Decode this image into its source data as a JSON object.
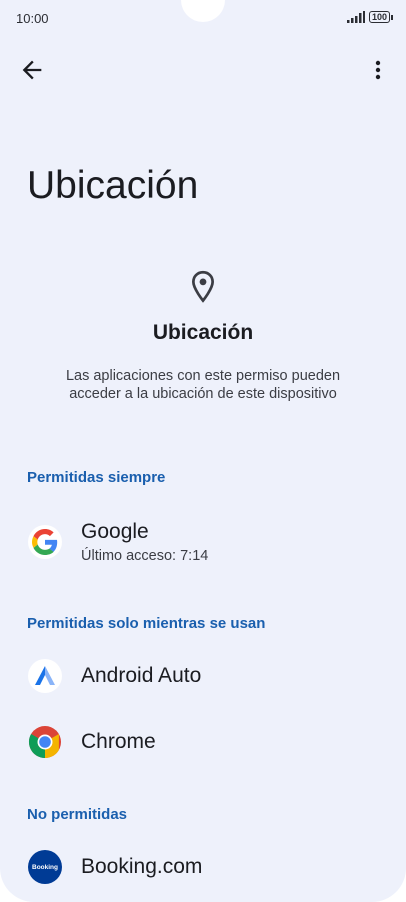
{
  "status_bar": {
    "time": "10:00",
    "battery": "100"
  },
  "page": {
    "title": "Ubicación"
  },
  "header": {
    "icon": "location-pin-icon",
    "title": "Ubicación",
    "description": "Las aplicaciones con este permiso pueden acceder a la ubicación de este dispositivo"
  },
  "sections": [
    {
      "label": "Permitidas siempre",
      "apps": [
        {
          "name": "Google",
          "subtitle": "Último acceso: 7:14",
          "icon": "google-icon"
        }
      ]
    },
    {
      "label": "Permitidas solo mientras se usan",
      "apps": [
        {
          "name": "Android Auto",
          "icon": "android-auto-icon"
        },
        {
          "name": "Chrome",
          "icon": "chrome-icon"
        }
      ]
    },
    {
      "label": "No permitidas",
      "apps": [
        {
          "name": "Booking.com",
          "icon": "booking-icon",
          "badge": "Booking"
        }
      ]
    }
  ],
  "colors": {
    "background": "#eef1fb",
    "accent": "#1a5fae",
    "text": "#1b1c21"
  }
}
